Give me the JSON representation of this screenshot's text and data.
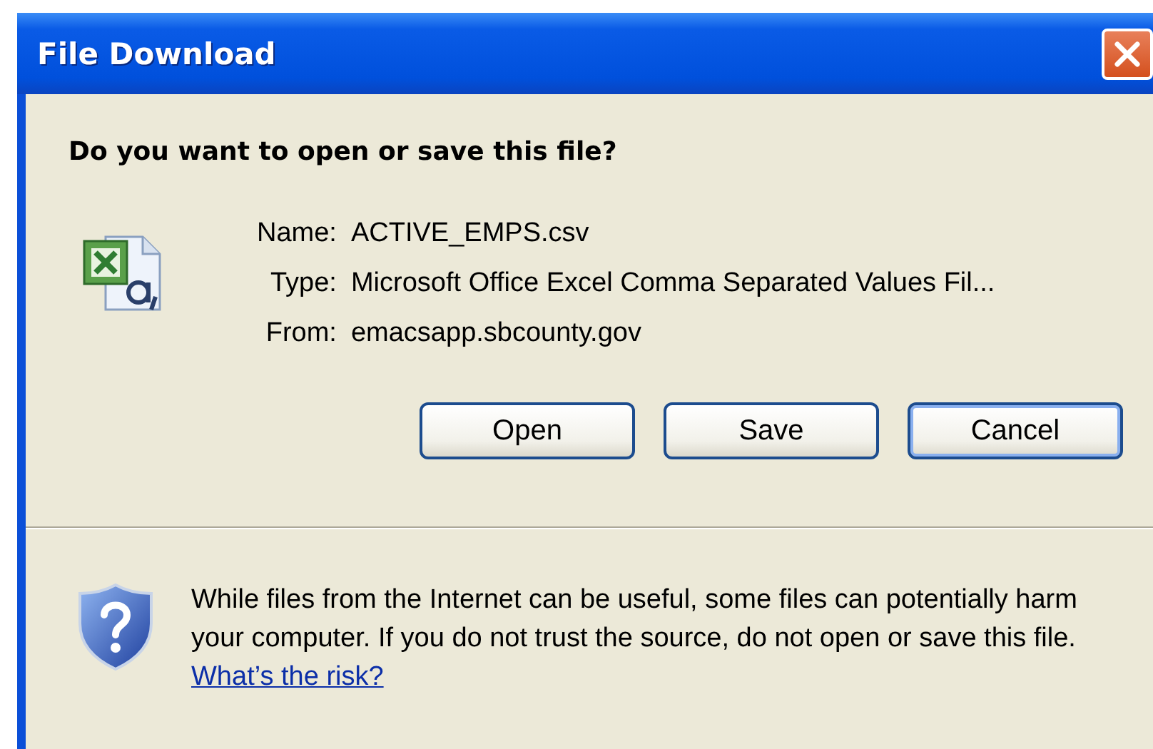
{
  "window": {
    "title": "File Download"
  },
  "question": "Do you want to open or save this file?",
  "file_info": [
    {
      "label": "Name:",
      "value": "ACTIVE_EMPS.csv"
    },
    {
      "label": "Type:",
      "value": "Microsoft Office Excel Comma Separated Values Fil..."
    },
    {
      "label": "From:",
      "value": "emacsapp.sbcounty.gov"
    }
  ],
  "buttons": [
    {
      "label": "Open",
      "default": false
    },
    {
      "label": "Save",
      "default": false
    },
    {
      "label": "Cancel",
      "default": true
    }
  ],
  "warning": {
    "text": "While files from the Internet can be useful, some files can potentially harm your computer. If you do not trust the source, do not open or save this file.",
    "link": "What’s the risk?"
  }
}
